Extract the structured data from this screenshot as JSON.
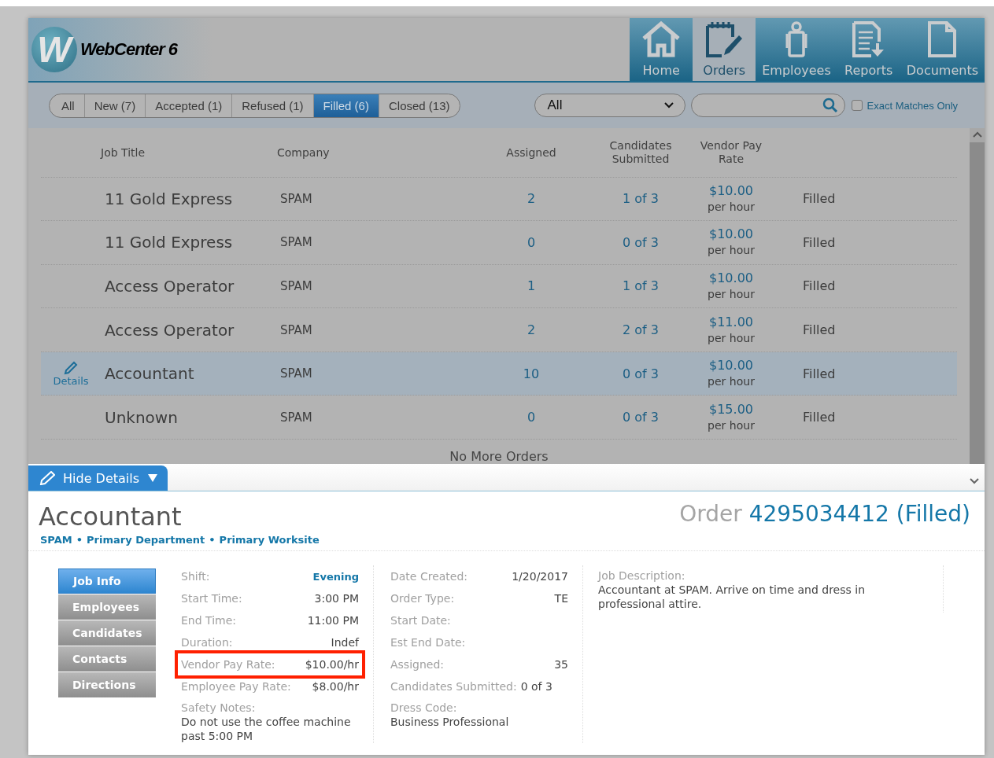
{
  "header": {
    "logo_mark": "W",
    "app_name": "WebCenter 6",
    "nav": [
      {
        "kind": "home",
        "label": "Home",
        "selected": false
      },
      {
        "kind": "orders",
        "label": "Orders",
        "selected": true
      },
      {
        "kind": "employees",
        "label": "Employees",
        "selected": false
      },
      {
        "kind": "reports",
        "label": "Reports",
        "selected": false
      },
      {
        "kind": "documents",
        "label": "Documents",
        "selected": false
      }
    ]
  },
  "filters": {
    "tabs": [
      {
        "label": "All",
        "selected": false
      },
      {
        "label": "New (7)",
        "selected": false
      },
      {
        "label": "Accepted (1)",
        "selected": false
      },
      {
        "label": "Refused (1)",
        "selected": false
      },
      {
        "label": "Filled (6)",
        "selected": true
      },
      {
        "label": "Closed (13)",
        "selected": false
      }
    ],
    "dropdown": {
      "value": "All"
    },
    "exact_matches": {
      "label": "Exact Matches Only",
      "checked": false
    }
  },
  "table": {
    "columns": [
      "Job Title",
      "Company",
      "Assigned",
      "Candidates Submitted",
      "Vendor Pay Rate"
    ],
    "row_action": "Details",
    "rows": [
      {
        "title": "11 Gold Express",
        "company": "SPAM",
        "assigned": "2",
        "candidates": "1 of 3",
        "pay": "$10.00",
        "pay_unit": "per hour",
        "status": "Filled",
        "selected": false
      },
      {
        "title": "11 Gold Express",
        "company": "SPAM",
        "assigned": "0",
        "candidates": "0 of 3",
        "pay": "$10.00",
        "pay_unit": "per hour",
        "status": "Filled",
        "selected": false
      },
      {
        "title": "Access Operator",
        "company": "SPAM",
        "assigned": "1",
        "candidates": "1 of 3",
        "pay": "$10.00",
        "pay_unit": "per hour",
        "status": "Filled",
        "selected": false
      },
      {
        "title": "Access Operator",
        "company": "SPAM",
        "assigned": "2",
        "candidates": "2 of 3",
        "pay": "$11.00",
        "pay_unit": "per hour",
        "status": "Filled",
        "selected": false
      },
      {
        "title": "Accountant",
        "company": "SPAM",
        "assigned": "10",
        "candidates": "0 of 3",
        "pay": "$10.00",
        "pay_unit": "per hour",
        "status": "Filled",
        "selected": true
      },
      {
        "title": "Unknown",
        "company": "SPAM",
        "assigned": "0",
        "candidates": "0 of 3",
        "pay": "$15.00",
        "pay_unit": "per hour",
        "status": "Filled",
        "selected": false
      }
    ],
    "footer": "No More Orders"
  },
  "details": {
    "toggle": "Hide Details",
    "title": "Accountant",
    "order_label": "Order",
    "order_value": "4295034412 (Filled)",
    "breadcrumb": [
      "SPAM",
      "Primary Department",
      "Primary Worksite"
    ],
    "breadcrumb_separator": "•",
    "menu": [
      {
        "label": "Job Info",
        "selected": true
      },
      {
        "label": "Employees",
        "selected": false
      },
      {
        "label": "Candidates",
        "selected": false
      },
      {
        "label": "Contacts",
        "selected": false
      },
      {
        "label": "Directions",
        "selected": false
      }
    ],
    "columns": [
      [
        {
          "kind": "pair",
          "label": "Shift:",
          "value": "Evening",
          "emphasis": true,
          "highlighted": false
        },
        {
          "kind": "pair",
          "label": "Start Time:",
          "value": "3:00 PM",
          "emphasis": false,
          "highlighted": false
        },
        {
          "kind": "pair",
          "label": "End Time:",
          "value": "11:00 PM",
          "emphasis": false,
          "highlighted": false
        },
        {
          "kind": "pair",
          "label": "Duration:",
          "value": "Indef",
          "emphasis": false,
          "highlighted": false
        },
        {
          "kind": "pair",
          "label": "Vendor Pay Rate:",
          "value": "$10.00/hr",
          "emphasis": false,
          "highlighted": true
        },
        {
          "kind": "pair",
          "label": "Employee Pay Rate:",
          "value": "$8.00/hr",
          "emphasis": false,
          "highlighted": false
        },
        {
          "kind": "block",
          "label": "Safety Notes:",
          "value": "Do not use the coffee machine past 5:00 PM"
        }
      ],
      [
        {
          "kind": "pair",
          "label": "Date Created:",
          "value": "1/20/2017",
          "emphasis": false,
          "highlighted": false
        },
        {
          "kind": "pair",
          "label": "Order Type:",
          "value": "TE",
          "emphasis": false,
          "highlighted": false
        },
        {
          "kind": "pair",
          "label": "Start Date:",
          "highlighted": false
        },
        {
          "kind": "pair",
          "label": "Est End Date:",
          "highlighted": false
        },
        {
          "kind": "pair",
          "label": "Assigned:",
          "value": "35",
          "emphasis": false,
          "highlighted": false
        },
        {
          "kind": "inline",
          "label": "Candidates Submitted:",
          "value": "0 of 3"
        },
        {
          "kind": "block",
          "label": "Dress Code:",
          "value": "Business Professional"
        }
      ],
      [
        {
          "kind": "block",
          "label": "Job Description:",
          "value": "Accountant at SPAM. Arrive on time and dress in professional attire."
        }
      ]
    ]
  }
}
